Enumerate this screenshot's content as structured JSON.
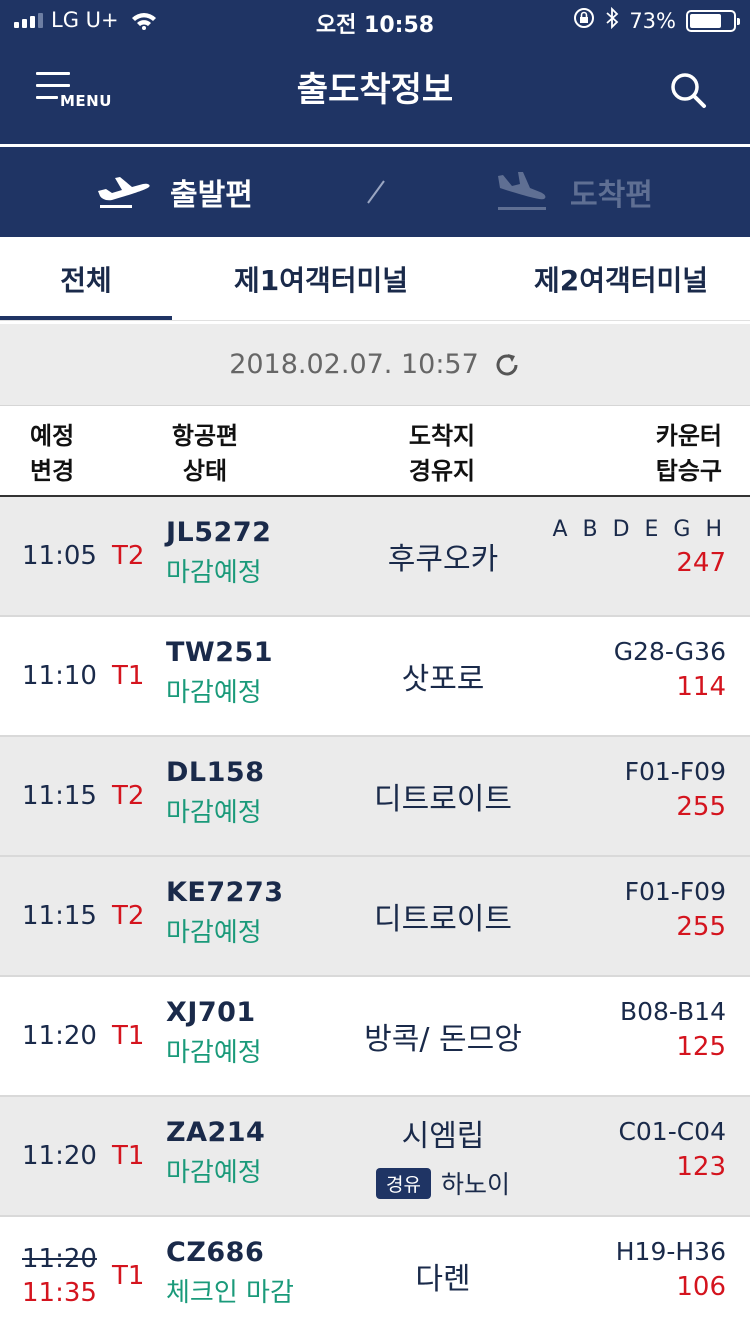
{
  "status_bar": {
    "carrier": "LG U+",
    "time": "오전 10:58",
    "battery": "73%",
    "battery_level": 0.73
  },
  "header": {
    "menu_label": "MENU",
    "title": "출도착정보"
  },
  "mode_toggle": {
    "departures": "출발편",
    "arrivals": "도착편",
    "active": "departures"
  },
  "tabs": [
    {
      "label": "전체",
      "active": true
    },
    {
      "label": "제1여객터미널",
      "active": false
    },
    {
      "label": "제2여객터미널",
      "active": false
    }
  ],
  "updated_at": "2018.02.07. 10:57",
  "columns": {
    "time_line1": "예정",
    "time_line2": "변경",
    "flight_line1": "항공편",
    "flight_line2": "상태",
    "dest_line1": "도착지",
    "dest_line2": "경유지",
    "counter_line1": "카운터",
    "counter_line2": "탑승구"
  },
  "flights": [
    {
      "time": "11:05",
      "terminal": "T2",
      "flight": "JL5272",
      "status": "마감예정",
      "destination": "후쿠오카",
      "counter": "A B D E G H",
      "gate": "247"
    },
    {
      "time": "11:10",
      "terminal": "T1",
      "flight": "TW251",
      "status": "마감예정",
      "destination": "삿포로",
      "counter": "G28-G36",
      "gate": "114"
    },
    {
      "time": "11:15",
      "terminal": "T2",
      "flight": "DL158",
      "status": "마감예정",
      "destination": "디트로이트",
      "counter": "F01-F09",
      "gate": "255"
    },
    {
      "time": "11:15",
      "terminal": "T2",
      "flight": "KE7273",
      "status": "마감예정",
      "destination": "디트로이트",
      "counter": "F01-F09",
      "gate": "255"
    },
    {
      "time": "11:20",
      "terminal": "T1",
      "flight": "XJ701",
      "status": "마감예정",
      "destination": "방콕/ 돈므앙",
      "counter": "B08-B14",
      "gate": "125"
    },
    {
      "time": "11:20",
      "terminal": "T1",
      "flight": "ZA214",
      "status": "마감예정",
      "destination": "시엠립",
      "via_label": "경유",
      "via": "하노이",
      "counter": "C01-C04",
      "gate": "123"
    },
    {
      "time": "11:20",
      "changed_time": "11:35",
      "terminal": "T1",
      "flight": "CZ686",
      "status": "체크인 마감",
      "destination": "다롄",
      "counter": "H19-H36",
      "gate": "106"
    }
  ]
}
